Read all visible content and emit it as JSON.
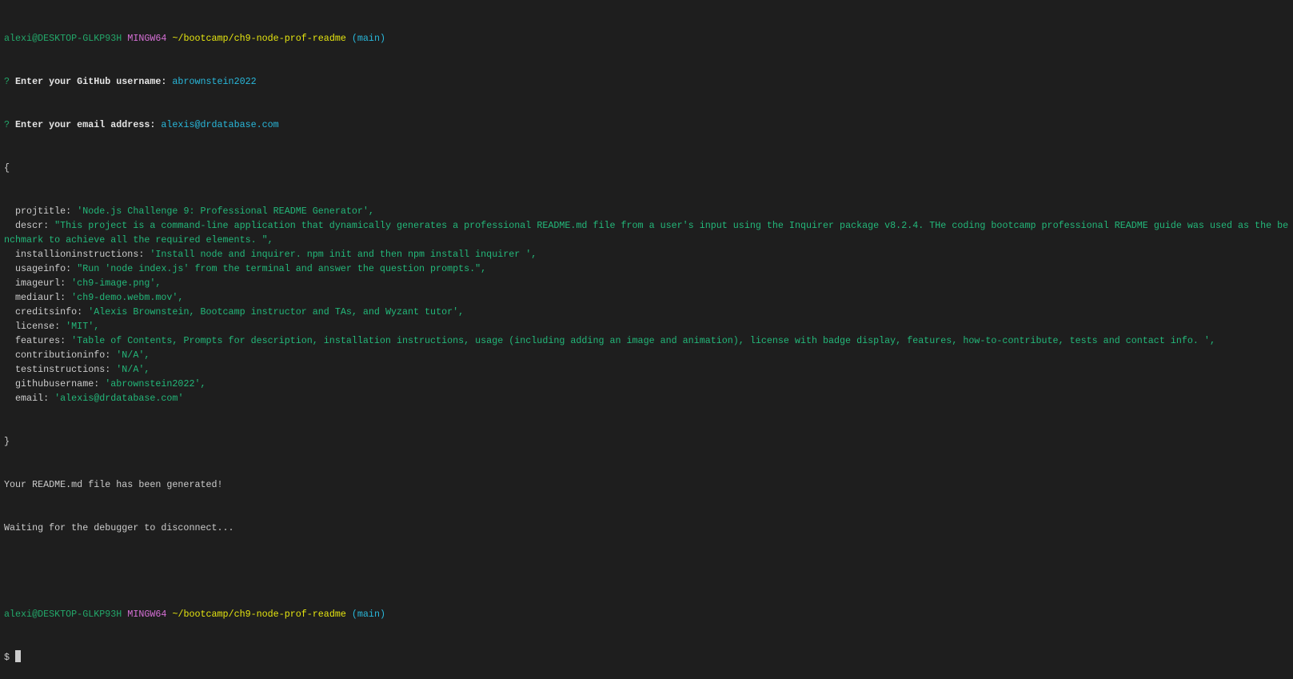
{
  "prompt": {
    "user_host": "alexi@DESKTOP-GLKP93H",
    "env": "MINGW64",
    "path": "~/bootcamp/ch9-node-prof-readme",
    "branch": "(main)"
  },
  "questions": [
    {
      "mark": "?",
      "label": "Enter your GitHub username:",
      "answer": "abrownstein2022"
    },
    {
      "mark": "?",
      "label": "Enter your email address:",
      "answer": "alexis@drdatabase.com"
    }
  ],
  "open_brace": "{",
  "close_brace": "}",
  "fields": [
    {
      "key": "  projtitle: ",
      "value": "'Node.js Challenge 9: Professional README Generator',"
    },
    {
      "key": "  descr: ",
      "value": "\"This project is a command-line application that dynamically generates a professional README.md file from a user's input using the Inquirer package v8.2.4. THe coding bootcamp professional README guide was used as the benchmark to achieve all the required elements. \","
    },
    {
      "key": "  installioninstructions: ",
      "value": "'Install node and inquirer. npm init and then npm install inquirer ',"
    },
    {
      "key": "  usageinfo: ",
      "value": "\"Run 'node index.js' from the terminal and answer the question prompts.\","
    },
    {
      "key": "  imageurl: ",
      "value": "'ch9-image.png',"
    },
    {
      "key": "  mediaurl: ",
      "value": "'ch9-demo.webm.mov',"
    },
    {
      "key": "  creditsinfo: ",
      "value": "'Alexis Brownstein, Bootcamp instructor and TAs, and Wyzant tutor',"
    },
    {
      "key": "  license: ",
      "value": "'MIT',"
    },
    {
      "key": "  features: ",
      "value": "'Table of Contents, Prompts for description, installation instructions, usage (including adding an image and animation), license with badge display, features, how-to-contribute, tests and contact info. ',"
    },
    {
      "key": "  contributioninfo: ",
      "value": "'N/A',"
    },
    {
      "key": "  testinstructions: ",
      "value": "'N/A',"
    },
    {
      "key": "  githubusername: ",
      "value": "'abrownstein2022',"
    },
    {
      "key": "  email: ",
      "value": "'alexis@drdatabase.com'"
    }
  ],
  "messages": [
    "Your README.md file has been generated!",
    "Waiting for the debugger to disconnect..."
  ],
  "dollar": "$ "
}
